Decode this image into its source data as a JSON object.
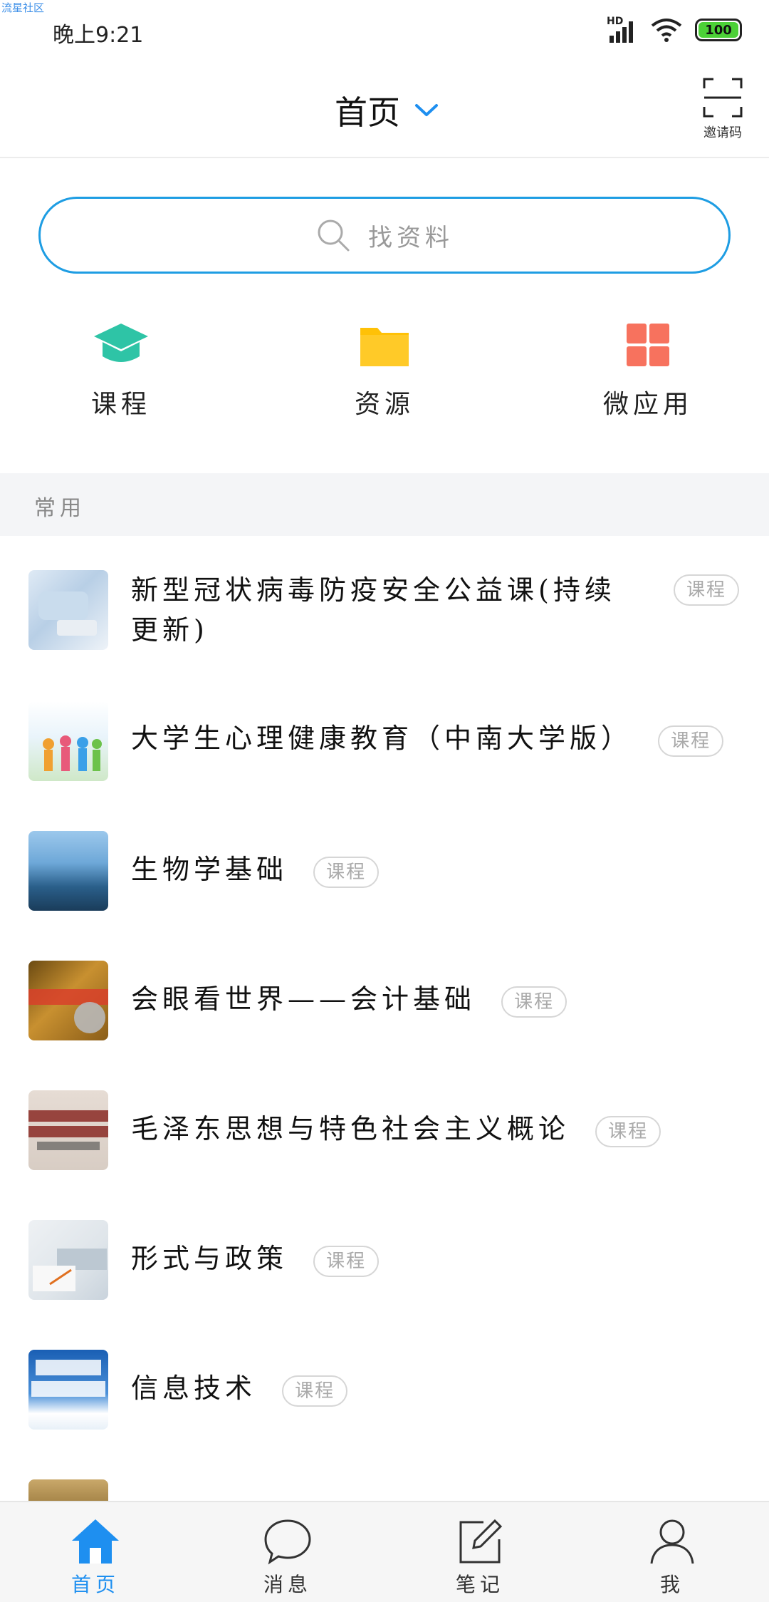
{
  "watermark": "流星社区",
  "status_bar": {
    "time": "晚上9:21",
    "network": "HD",
    "battery": "100"
  },
  "header": {
    "title": "首页",
    "invite_label": "邀请码"
  },
  "search": {
    "placeholder": "找资料"
  },
  "quick_entries": [
    {
      "label": "课程",
      "icon": "graduation-cap-icon",
      "color": "#2ec4a6"
    },
    {
      "label": "资源",
      "icon": "folder-icon",
      "color": "#ffc107"
    },
    {
      "label": "微应用",
      "icon": "apps-grid-icon",
      "color": "#f7725e"
    }
  ],
  "section": {
    "title": "常用"
  },
  "courses": [
    {
      "title": "新型冠状病毒防疫安全公益课(持续更新)",
      "badge": "课程"
    },
    {
      "title": "大学生心理健康教育（中南大学版）",
      "badge": "课程"
    },
    {
      "title": "生物学基础",
      "badge": "课程"
    },
    {
      "title": "会眼看世界——会计基础",
      "badge": "课程"
    },
    {
      "title": "毛泽东思想与特色社会主义概论",
      "badge": "课程"
    },
    {
      "title": "形式与政策",
      "badge": "课程"
    },
    {
      "title": "信息技术",
      "badge": "课程"
    }
  ],
  "bottom_nav": [
    {
      "label": "首页",
      "icon": "home-icon",
      "active": true
    },
    {
      "label": "消息",
      "icon": "message-icon",
      "active": false
    },
    {
      "label": "笔记",
      "icon": "note-icon",
      "active": false
    },
    {
      "label": "我",
      "icon": "profile-icon",
      "active": false
    }
  ],
  "colors": {
    "accent": "#1e8ff0",
    "search_border": "#1e9de3",
    "section_bg": "#f4f5f7"
  }
}
